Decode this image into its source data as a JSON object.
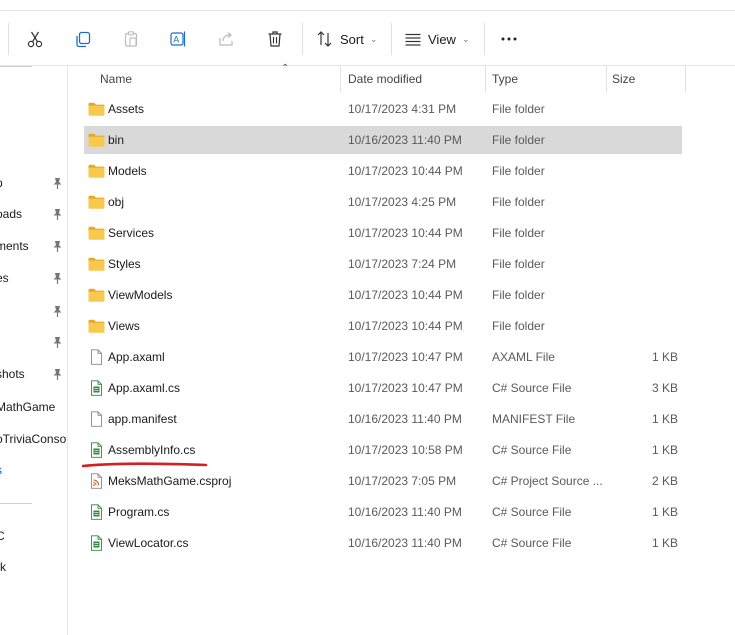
{
  "toolbar": {
    "sort_label": "Sort",
    "view_label": "View",
    "icons": [
      "cut-icon",
      "copy-icon",
      "paste-icon",
      "rename-icon",
      "share-icon",
      "delete-icon",
      "sort-icon",
      "view-icon",
      "more-icon"
    ]
  },
  "nav": {
    "items": [
      {
        "label": "p",
        "pinned": true
      },
      {
        "label": "oads",
        "pinned": true
      },
      {
        "label": "ments",
        "pinned": true
      },
      {
        "label": "es",
        "pinned": true
      },
      {
        "label": "",
        "pinned": true
      },
      {
        "label": "",
        "pinned": true
      },
      {
        "label": "shots",
        "pinned": true
      },
      {
        "label": "MathGame",
        "pinned": false
      },
      {
        "label": "oTriviaConso",
        "pinned": false
      },
      {
        "label": "s",
        "pinned": false
      },
      {
        "label": "C",
        "pinned": false
      },
      {
        "label": "rk",
        "pinned": false
      }
    ]
  },
  "columns": {
    "name": "Name",
    "date": "Date modified",
    "type": "Type",
    "size": "Size"
  },
  "files": [
    {
      "name": "Assets",
      "date": "10/17/2023 4:31 PM",
      "type": "File folder",
      "size": "",
      "kind": "folder"
    },
    {
      "name": "bin",
      "date": "10/16/2023 11:40 PM",
      "type": "File folder",
      "size": "",
      "kind": "folder",
      "selected": true
    },
    {
      "name": "Models",
      "date": "10/17/2023 10:44 PM",
      "type": "File folder",
      "size": "",
      "kind": "folder"
    },
    {
      "name": "obj",
      "date": "10/17/2023 4:25 PM",
      "type": "File folder",
      "size": "",
      "kind": "folder"
    },
    {
      "name": "Services",
      "date": "10/17/2023 10:44 PM",
      "type": "File folder",
      "size": "",
      "kind": "folder"
    },
    {
      "name": "Styles",
      "date": "10/17/2023 7:24 PM",
      "type": "File folder",
      "size": "",
      "kind": "folder"
    },
    {
      "name": "ViewModels",
      "date": "10/17/2023 10:44 PM",
      "type": "File folder",
      "size": "",
      "kind": "folder"
    },
    {
      "name": "Views",
      "date": "10/17/2023 10:44 PM",
      "type": "File folder",
      "size": "",
      "kind": "folder"
    },
    {
      "name": "App.axaml",
      "date": "10/17/2023 10:47 PM",
      "type": "AXAML File",
      "size": "1 KB",
      "kind": "file"
    },
    {
      "name": "App.axaml.cs",
      "date": "10/17/2023 10:47 PM",
      "type": "C# Source File",
      "size": "3 KB",
      "kind": "cs"
    },
    {
      "name": "app.manifest",
      "date": "10/16/2023 11:40 PM",
      "type": "MANIFEST File",
      "size": "1 KB",
      "kind": "file"
    },
    {
      "name": "AssemblyInfo.cs",
      "date": "10/17/2023 10:58 PM",
      "type": "C# Source File",
      "size": "1 KB",
      "kind": "cs"
    },
    {
      "name": "MeksMathGame.csproj",
      "date": "10/17/2023 7:05 PM",
      "type": "C# Project Source ...",
      "size": "2 KB",
      "kind": "csproj"
    },
    {
      "name": "Program.cs",
      "date": "10/16/2023 11:40 PM",
      "type": "C# Source File",
      "size": "1 KB",
      "kind": "cs"
    },
    {
      "name": "ViewLocator.cs",
      "date": "10/16/2023 11:40 PM",
      "type": "C# Source File",
      "size": "1 KB",
      "kind": "cs"
    }
  ],
  "colors": {
    "folder": "#f8c94c",
    "folder_dark": "#e5a92a",
    "cs_green": "#2e8b3e",
    "csproj_orange": "#d25a2a",
    "selection": "#d9d9d9",
    "annotation": "#d42020",
    "accent": "#0067c0"
  }
}
